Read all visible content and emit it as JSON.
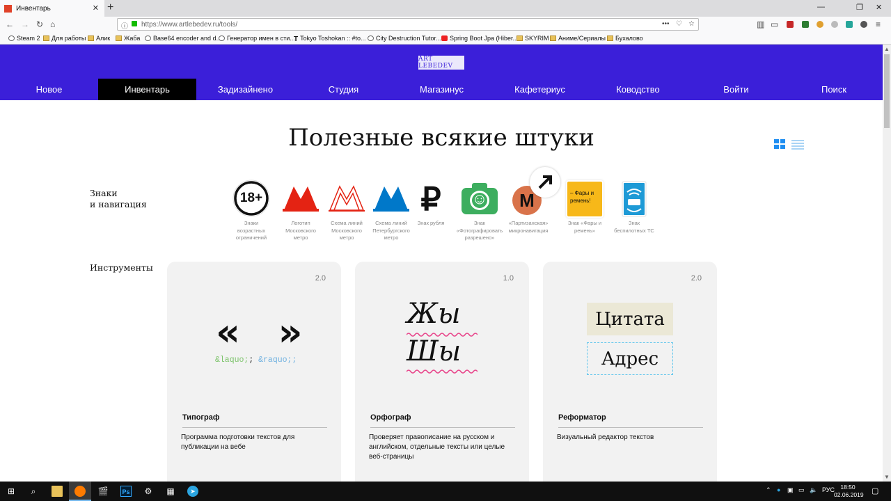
{
  "browser": {
    "tab_title": "Инвентарь",
    "tab_close": "✕",
    "new_tab": "+",
    "url": "https://www.artlebedev.ru/tools/",
    "url_menu": "•••",
    "bookmarks": [
      {
        "label": "Steam 2",
        "icon": "globe"
      },
      {
        "label": "Для работы",
        "icon": "folder"
      },
      {
        "label": "Алик",
        "icon": "folder"
      },
      {
        "label": "Жаба",
        "icon": "folder"
      },
      {
        "label": "Base64 encoder and d...",
        "icon": "globe"
      },
      {
        "label": "Генератор имен в сти...",
        "icon": "globe"
      },
      {
        "label": "Tokyo Toshokan :: #to...",
        "icon": "t"
      },
      {
        "label": "City Destruction Tutor...",
        "icon": "globe"
      },
      {
        "label": "Spring Boot Jpa (Hiber...",
        "icon": "red"
      },
      {
        "label": "SKYRIM",
        "icon": "folder"
      },
      {
        "label": "Аниме/Сериалы",
        "icon": "folder"
      },
      {
        "label": "Бухалово",
        "icon": "folder"
      }
    ]
  },
  "site": {
    "logo": "ART LEBEDEV",
    "menu": [
      {
        "label": "Новое",
        "active": false
      },
      {
        "label": "Инвентарь",
        "active": true
      },
      {
        "label": "Задизайнено",
        "active": false
      },
      {
        "label": "Студия",
        "active": false
      },
      {
        "label": "Магазинус",
        "active": false
      },
      {
        "label": "Кафетериус",
        "active": false
      },
      {
        "label": "Ководство",
        "active": false
      },
      {
        "label": "Войти",
        "active": false
      },
      {
        "label": "Поиск",
        "active": false
      }
    ],
    "accent_color": "#3b1fd9"
  },
  "page": {
    "title": "Полезные всякие штуки",
    "signs_section": {
      "label_line1": "Знаки",
      "label_line2": "и навигация",
      "items": [
        {
          "icon": "age-18-plus-icon",
          "badge": "18+",
          "caption": "Знаки возрастных ограничений"
        },
        {
          "icon": "moscow-metro-logo-icon",
          "badge": "M",
          "caption": "Логотип Московского метро"
        },
        {
          "icon": "metro-lines-scheme-icon",
          "badge": "M",
          "caption": "Схема линий Московского метро"
        },
        {
          "icon": "spb-metro-lines-icon",
          "badge": "M",
          "caption": "Схема линий Петербургского метро"
        },
        {
          "icon": "ruble-sign-icon",
          "badge": "₽",
          "caption": "Знак рубля"
        },
        {
          "icon": "camera-allowed-icon",
          "badge": "☺",
          "caption": "Знак «Фотографировать разрешено»"
        },
        {
          "icon": "partisan-navigation-icon",
          "badge": "M",
          "caption": "«Партизанская» микронавигация"
        },
        {
          "icon": "headlights-belt-icon",
          "badge": "– Фары и ремень!",
          "caption": "Знак «Фары и ремень»"
        },
        {
          "icon": "driverless-vehicle-icon",
          "badge": "",
          "caption": "Знак беспилотных ТС"
        }
      ]
    },
    "tools_section": {
      "label": "Инструменты",
      "cards": [
        {
          "name": "Типограф",
          "version": "2.0",
          "desc": "Программа подготовки текстов для публикации на вебе",
          "quotes": "« »",
          "entity_left": "&laquo;",
          "entity_right": "&raquo;"
        },
        {
          "name": "Орфограф",
          "version": "1.0",
          "desc": "Проверяет правописание на русском и английском, отдельные тексты или целые веб-страницы",
          "word1": "Жы",
          "word2": "Шы"
        },
        {
          "name": "Реформатор",
          "version": "2.0",
          "desc": "Визуальный редактор текстов",
          "box1": "Цитата",
          "box2": "Адрес"
        }
      ]
    }
  },
  "taskbar": {
    "lang": "РУС",
    "time": "18:50",
    "date": "02.06.2019"
  }
}
